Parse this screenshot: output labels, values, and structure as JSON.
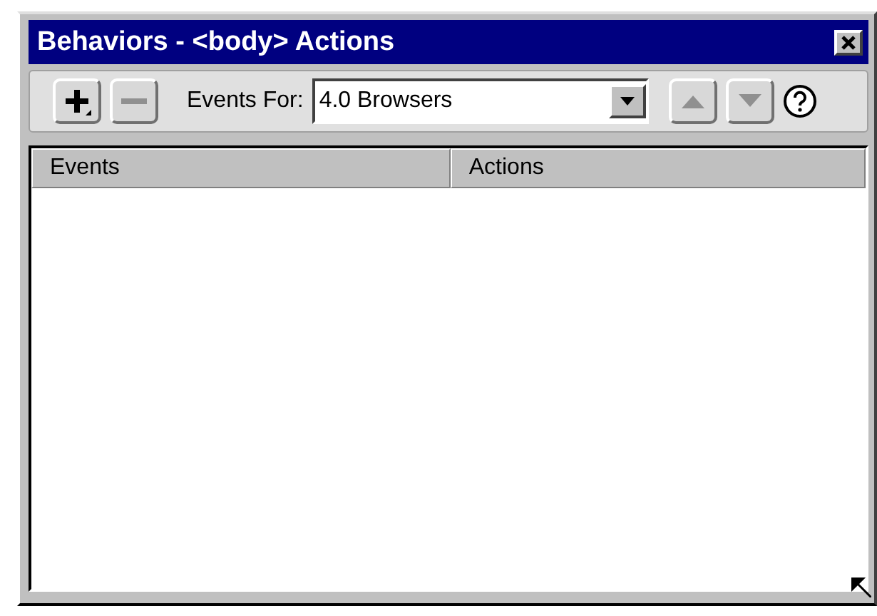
{
  "window": {
    "title": "Behaviors - <body> Actions"
  },
  "toolbar": {
    "add_button": {
      "disabled": false
    },
    "remove_button": {
      "disabled": true
    },
    "events_for": {
      "label": "Events For:",
      "value": "4.0 Browsers"
    },
    "move_up_button": {
      "disabled": true
    },
    "move_down_button": {
      "disabled": true
    }
  },
  "table": {
    "columns": [
      "Events",
      "Actions"
    ]
  }
}
